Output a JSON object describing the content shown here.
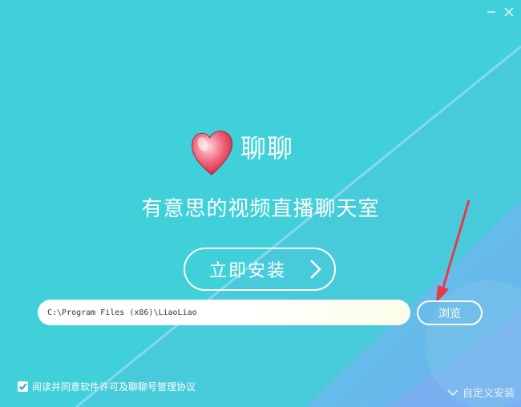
{
  "window": {
    "minimize_label": "—",
    "close_label": "✕"
  },
  "app": {
    "name": "聊聊",
    "tagline": "有意思的视频直播聊天室",
    "logo_icon": "heart-logo-icon"
  },
  "install": {
    "button_label": "立即安装"
  },
  "path": {
    "value": "C:\\Program Files (x86)\\LiaoLiao"
  },
  "browse": {
    "label": "浏览"
  },
  "agreement": {
    "checked": true,
    "text": "阅读并同意软件许可及聊聊号管理协议"
  },
  "custom_install": {
    "label": "自定义安装"
  },
  "colors": {
    "background": "#40d0d9",
    "diagonal_band": "#6fb0f0",
    "arrow": "#e8384a",
    "text": "#ffffff"
  }
}
